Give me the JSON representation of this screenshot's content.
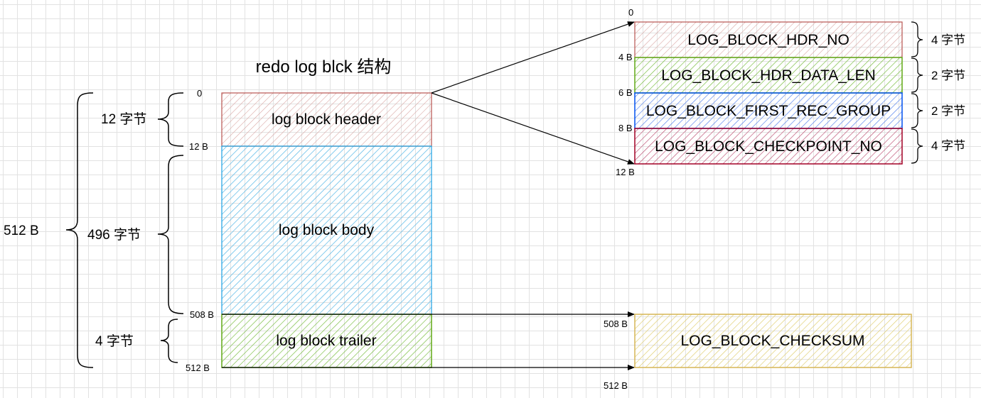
{
  "title": "redo log blck 结构",
  "colors": {
    "header": "#b85450",
    "body": "#1ba1e2",
    "trailer": "#60a917",
    "hdr_no": "#b85450",
    "data_len": "#60a917",
    "first_rec_group": "#0050ef",
    "checkpoint_no": "#a20025",
    "checksum": "#d6b656"
  },
  "block": {
    "header_label": "log block header",
    "body_label": "log block body",
    "trailer_label": "log block trailer"
  },
  "offsets": {
    "zero": "0",
    "b12": "12 B",
    "b508": "508 B",
    "b512": "512 B"
  },
  "sizes": {
    "total": "512 B",
    "header": "12 字节",
    "body": "496 字节",
    "trailer": "4 字节"
  },
  "header_fields": [
    {
      "name": "LOG_BLOCK_HDR_NO",
      "size": "4 字节",
      "start": "0"
    },
    {
      "name": "LOG_BLOCK_HDR_DATA_LEN",
      "size": "2 字节",
      "start": "4 B"
    },
    {
      "name": "LOG_BLOCK_FIRST_REC_GROUP",
      "size": "2 字节",
      "start": "6 B"
    },
    {
      "name": "LOG_BLOCK_CHECKPOINT_NO",
      "size": "4 字节",
      "start": "8 B"
    }
  ],
  "header_end": "12 B",
  "trailer_field": {
    "name": "LOG_BLOCK_CHECKSUM",
    "start": "508 B",
    "end": "512 B"
  }
}
